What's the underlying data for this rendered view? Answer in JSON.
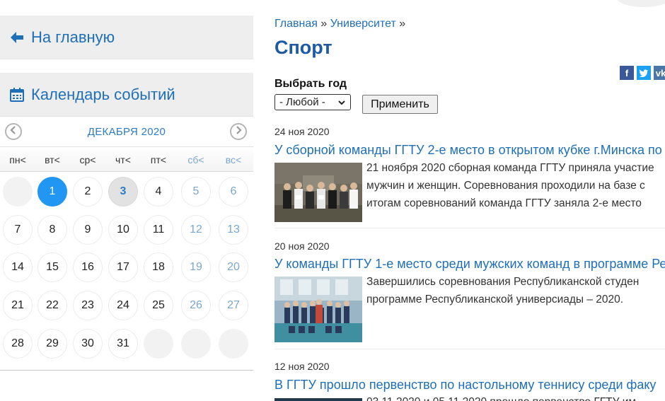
{
  "sidebar": {
    "home_label": "На главную",
    "calendar_label": "Календарь событий",
    "calendar": {
      "month_label": "ДЕКАБРЯ 2020",
      "weekdays": [
        {
          "label": "пн<",
          "weekend": false
        },
        {
          "label": "вт<",
          "weekend": false
        },
        {
          "label": "ср<",
          "weekend": false
        },
        {
          "label": "чт<",
          "weekend": false
        },
        {
          "label": "пт<",
          "weekend": false
        },
        {
          "label": "сб<",
          "weekend": true
        },
        {
          "label": "вс<",
          "weekend": true
        }
      ],
      "weeks": [
        [
          "",
          "1",
          "2",
          "3",
          "4",
          "5",
          "6"
        ],
        [
          "7",
          "8",
          "9",
          "10",
          "11",
          "12",
          "13"
        ],
        [
          "14",
          "15",
          "16",
          "17",
          "18",
          "19",
          "20"
        ],
        [
          "21",
          "22",
          "23",
          "24",
          "25",
          "26",
          "27"
        ],
        [
          "28",
          "29",
          "30",
          "31",
          "",
          "",
          ""
        ]
      ],
      "today": "1",
      "selected": "3"
    }
  },
  "breadcrumb": {
    "home": "Главная",
    "separator": "»",
    "university": "Университет",
    "trail_end": "»"
  },
  "page_title": "Спорт",
  "share": {
    "facebook": "f",
    "twitter": "t",
    "vk": "vk"
  },
  "filter": {
    "label": "Выбрать год",
    "selected_year": "- Любой -",
    "apply_label": "Применить"
  },
  "news": [
    {
      "date": "24 ноя 2020",
      "title": "У сборной команды ГГТУ 2-е место в открытом кубке г.Минска по",
      "text": "  21 ноября 2020 сборная команда ГГТУ приняла участие\nмужчин и женщин. Соревнования проходили на базе с\nитогам соревнований команда ГГТУ заняла 2-е место"
    },
    {
      "date": "20 ноя 2020",
      "title": "У команды ГГТУ 1-е место среди мужских команд в программе Ре",
      "text": "  Завершились соревнования Республиканской студен\nпрограмме Республиканской универсиады – 2020."
    },
    {
      "date": "12 ноя 2020",
      "title": "В ГГТУ прошло первенство по настольному теннису среди факу",
      "text": "03.11.2020 и 05.11.2020 прошло первенство ГГТУ им"
    }
  ],
  "colors": {
    "link": "#1e6fb8",
    "title": "#1e5aa5",
    "today": "#2196f3",
    "weekend": "#7aa6cf"
  }
}
